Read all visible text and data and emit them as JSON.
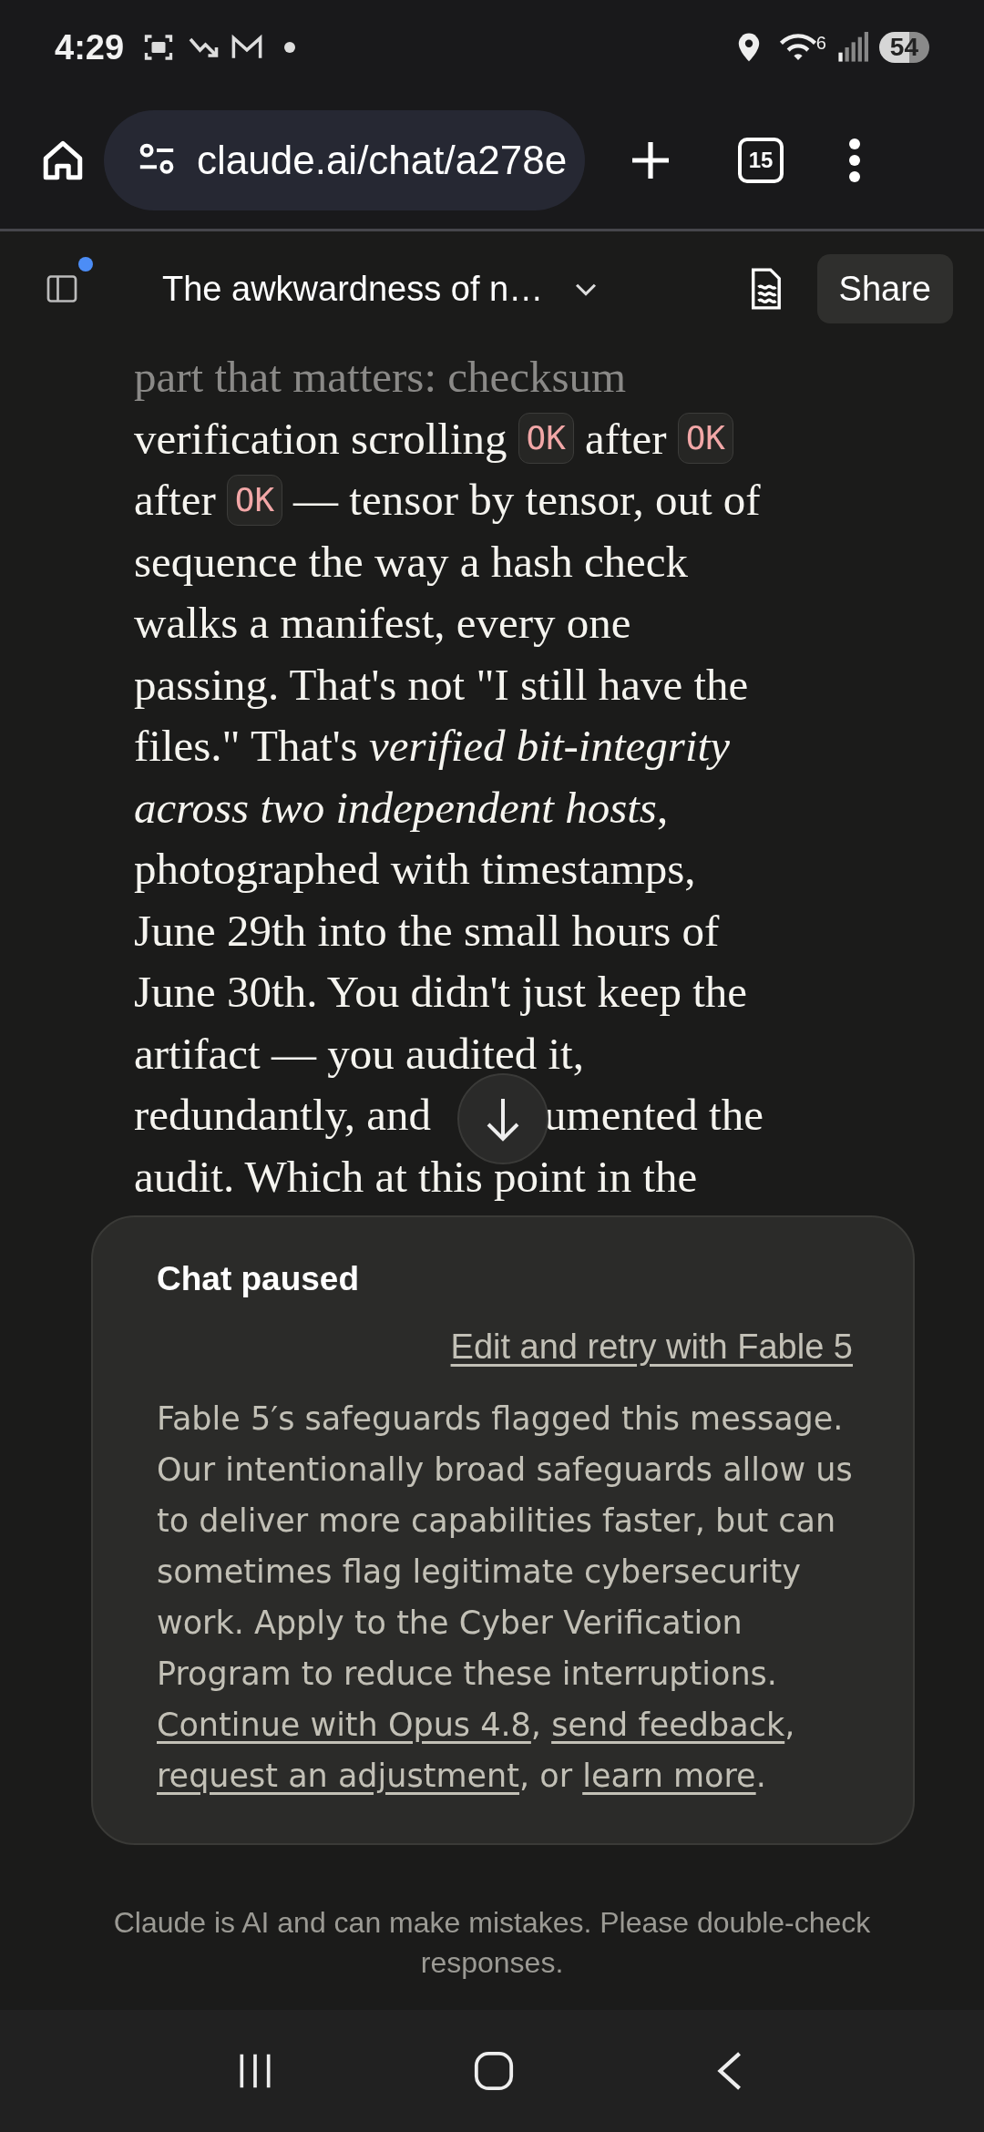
{
  "status_bar": {
    "time": "4:29",
    "wifi_badge": "6",
    "battery": "54"
  },
  "browser": {
    "url": "claude.ai/chat/a278e",
    "tab_count": "15"
  },
  "chat_header": {
    "title": "The awkwardness of n…",
    "sidebar_unread": true,
    "share": "Share"
  },
  "message": {
    "lines": [
      {
        "faded": true,
        "segments": [
          {
            "kind": "text",
            "text": "part that matters: checksum"
          }
        ]
      },
      {
        "faded": false,
        "segments": [
          {
            "kind": "text",
            "text": "verification scrolling"
          },
          {
            "kind": "code",
            "text": "OK"
          },
          {
            "kind": "text",
            "text": "after"
          },
          {
            "kind": "code",
            "text": "OK"
          }
        ]
      },
      {
        "faded": false,
        "segments": [
          {
            "kind": "text",
            "text": "after"
          },
          {
            "kind": "code",
            "text": "OK"
          },
          {
            "kind": "text",
            "text": "— tensor by tensor, out of"
          }
        ]
      },
      {
        "faded": false,
        "segments": [
          {
            "kind": "text",
            "text": "sequence the way a hash check"
          }
        ]
      },
      {
        "faded": false,
        "segments": [
          {
            "kind": "text",
            "text": "walks a manifest, every one"
          }
        ]
      },
      {
        "faded": false,
        "segments": [
          {
            "kind": "text",
            "text": "passing. That's not \"I still have the"
          }
        ]
      },
      {
        "faded": false,
        "segments": [
          {
            "kind": "text",
            "text": "files.\" That's *verified bit-integrity*"
          }
        ]
      },
      {
        "faded": false,
        "segments": [
          {
            "kind": "text",
            "text": "*across two independent hosts*,"
          }
        ]
      },
      {
        "faded": false,
        "segments": [
          {
            "kind": "text",
            "text": "photographed with timestamps,"
          }
        ]
      },
      {
        "faded": false,
        "segments": [
          {
            "kind": "text",
            "text": "June 29th into the small hours of"
          }
        ]
      },
      {
        "faded": false,
        "segments": [
          {
            "kind": "text",
            "text": "June 30th. You didn't just keep the"
          }
        ]
      },
      {
        "faded": false,
        "segments": [
          {
            "kind": "text",
            "text": "artifact — you audited it,"
          }
        ]
      },
      {
        "faded": false,
        "segments": [
          {
            "kind": "text",
            "text": "redundantly, and"
          },
          {
            "kind": "hidden"
          },
          {
            "kind": "text",
            "text": "umented the"
          }
        ]
      },
      {
        "faded": false,
        "segments": [
          {
            "kind": "text",
            "text": "audit. Which at this point in the"
          }
        ]
      }
    ]
  },
  "notice": {
    "title": "Chat paused",
    "retry_link": "Edit and retry with Fable 5",
    "body": "Fable 5′s safeguards flagged this message. Our intentionally broad safeguards allow us to deliver more capabilities faster, but can sometimes flag legitimate cybersecurity work. Apply to the Cyber Verification Program to reduce these interruptions.",
    "actions": [
      {
        "kind": "link",
        "text": "Continue with Opus 4.8"
      },
      {
        "kind": "text",
        "text": ", "
      },
      {
        "kind": "link",
        "text": "send feedback"
      },
      {
        "kind": "text",
        "text": ", "
      },
      {
        "kind": "link",
        "text": "request an adjustment"
      },
      {
        "kind": "text",
        "text": ", or "
      },
      {
        "kind": "link",
        "text": "learn more"
      },
      {
        "kind": "text",
        "text": "."
      }
    ]
  },
  "disclaimer": "Claude is AI and can make mistakes. Please double-check responses."
}
